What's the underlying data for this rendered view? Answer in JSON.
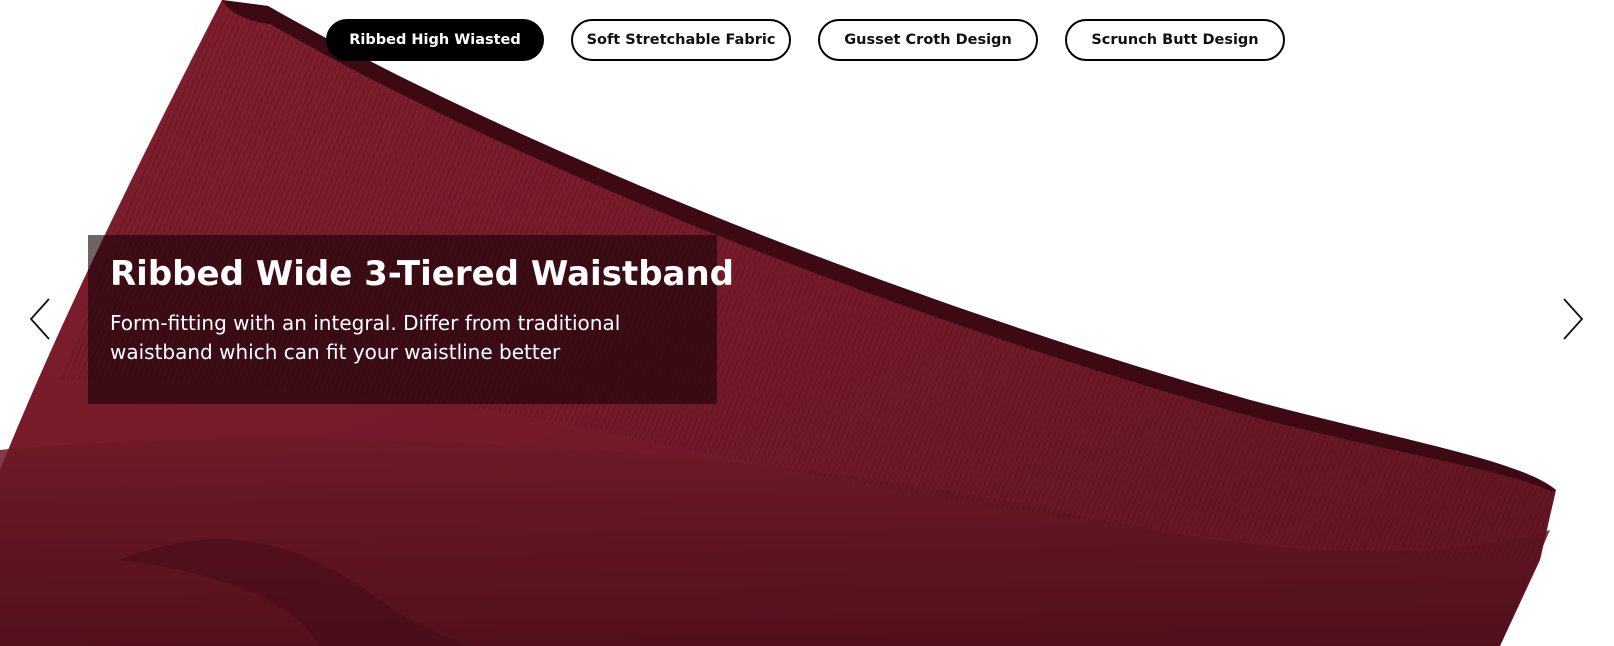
{
  "tabs": [
    {
      "label": "Ribbed High Wiasted",
      "active": true
    },
    {
      "label": "Soft Stretchable Fabric",
      "active": false
    },
    {
      "label": "Gusset Croth Design",
      "active": false
    },
    {
      "label": "Scrunch Butt Design",
      "active": false
    }
  ],
  "slide": {
    "title": "Ribbed Wide 3-Tiered Waistband",
    "description": "Form-fitting with an integral. Differ from traditional waistband which can fit your waistline better"
  },
  "navigation": {
    "prev_icon": "chevron-left-icon",
    "next_icon": "chevron-right-icon"
  },
  "colors": {
    "fabric": "#7a1d2b",
    "fabric_dark": "#5a1220",
    "active_tab_bg": "#000000",
    "caption_bg": "#1a0408"
  }
}
